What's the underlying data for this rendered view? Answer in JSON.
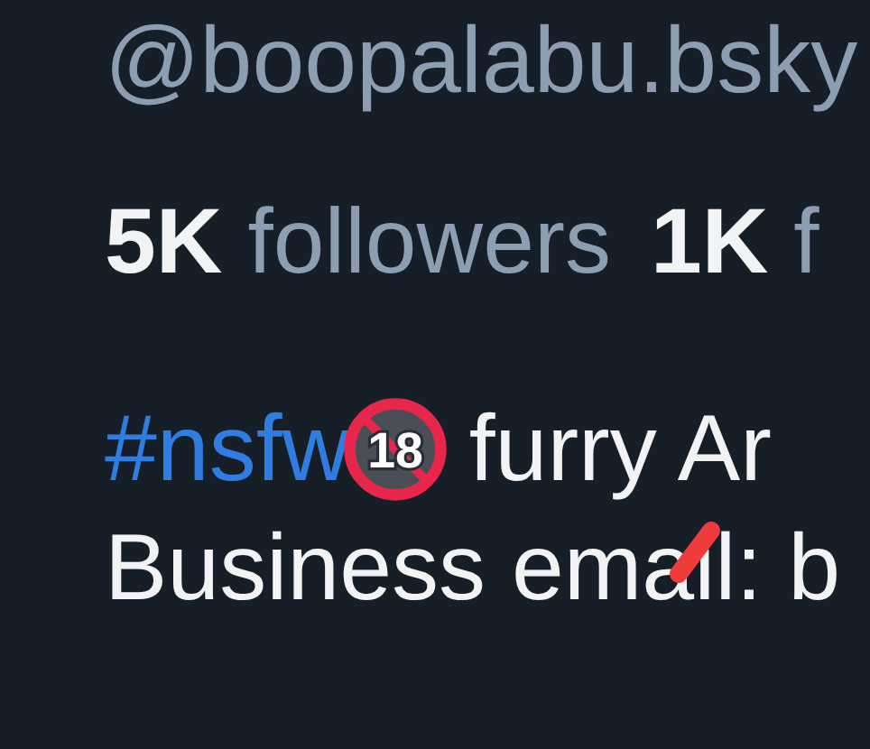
{
  "profile": {
    "handle": "@boopalabu.bsky",
    "stats": [
      {
        "count": "5K",
        "label": "followers"
      },
      {
        "count": "1K",
        "label": "f"
      }
    ],
    "bio": {
      "hashtag": "#nsfw",
      "icon_label": "18",
      "line_1_rest": "furry Ar",
      "line_2": "Business email: b",
      "redacted": true
    }
  }
}
